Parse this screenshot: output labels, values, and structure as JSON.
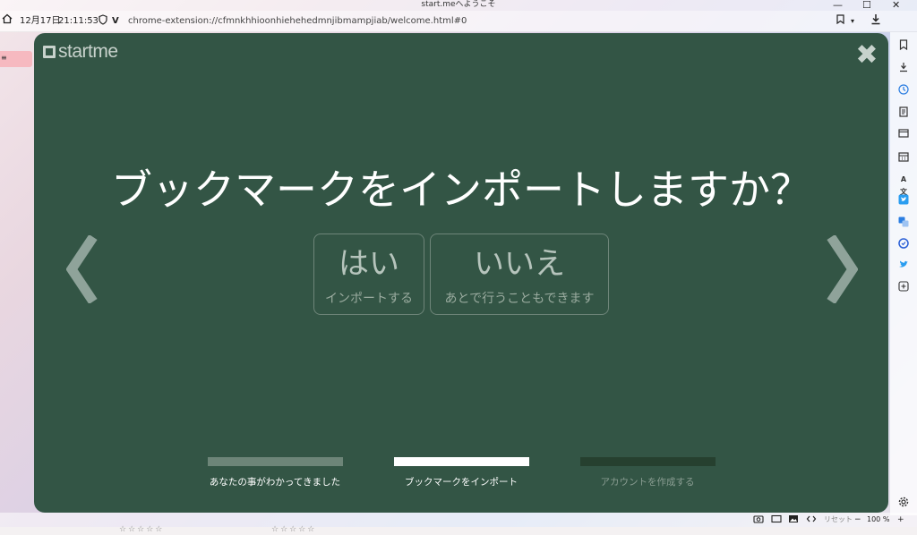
{
  "window": {
    "title": "start.meへようこそ",
    "controls": {
      "minimize": "—",
      "maximize": "☐",
      "close": "✕"
    }
  },
  "address_bar": {
    "home_icon": "home-icon",
    "date": "12月17日",
    "time": "21:11:53",
    "shield_icon": "shield-icon",
    "v_label": "V",
    "url": "chrome-extension://cfmnkhhioonhiehehedmnjibmampjiab/welcome.html#0"
  },
  "left_tab": {
    "label": "≡"
  },
  "sidebar": {
    "icons": [
      "bookmark-icon",
      "download-icon",
      "history-icon",
      "notes-icon",
      "window-icon",
      "calendar-icon",
      "translate-icon",
      "twitter-icon",
      "translator-icon",
      "clock-icon",
      "bird-icon",
      "add-panel-icon",
      "settings-icon"
    ],
    "translate_label": "A文"
  },
  "status_bar": {
    "reset_label": "リセット",
    "zoom": "100 %",
    "zoom_minus": "−",
    "zoom_plus": "+"
  },
  "modal": {
    "logo_text": "startme",
    "close_label": "✖",
    "question": "ブックマークをインポートしますか？",
    "yes": {
      "title": "はい",
      "subtitle": "インポートする"
    },
    "no": {
      "title": "いいえ",
      "subtitle": "あとで行うこともできます"
    },
    "steps": [
      {
        "label": "あなたの事がわかってきました",
        "state": "done"
      },
      {
        "label": "ブックマークをインポート",
        "state": "active"
      },
      {
        "label": "アカウントを作成する",
        "state": "pending"
      }
    ]
  },
  "colors": {
    "modal_bg": "#335545",
    "step_done": "#6d8578",
    "step_active": "#ffffff",
    "step_pending": "#26402f"
  }
}
